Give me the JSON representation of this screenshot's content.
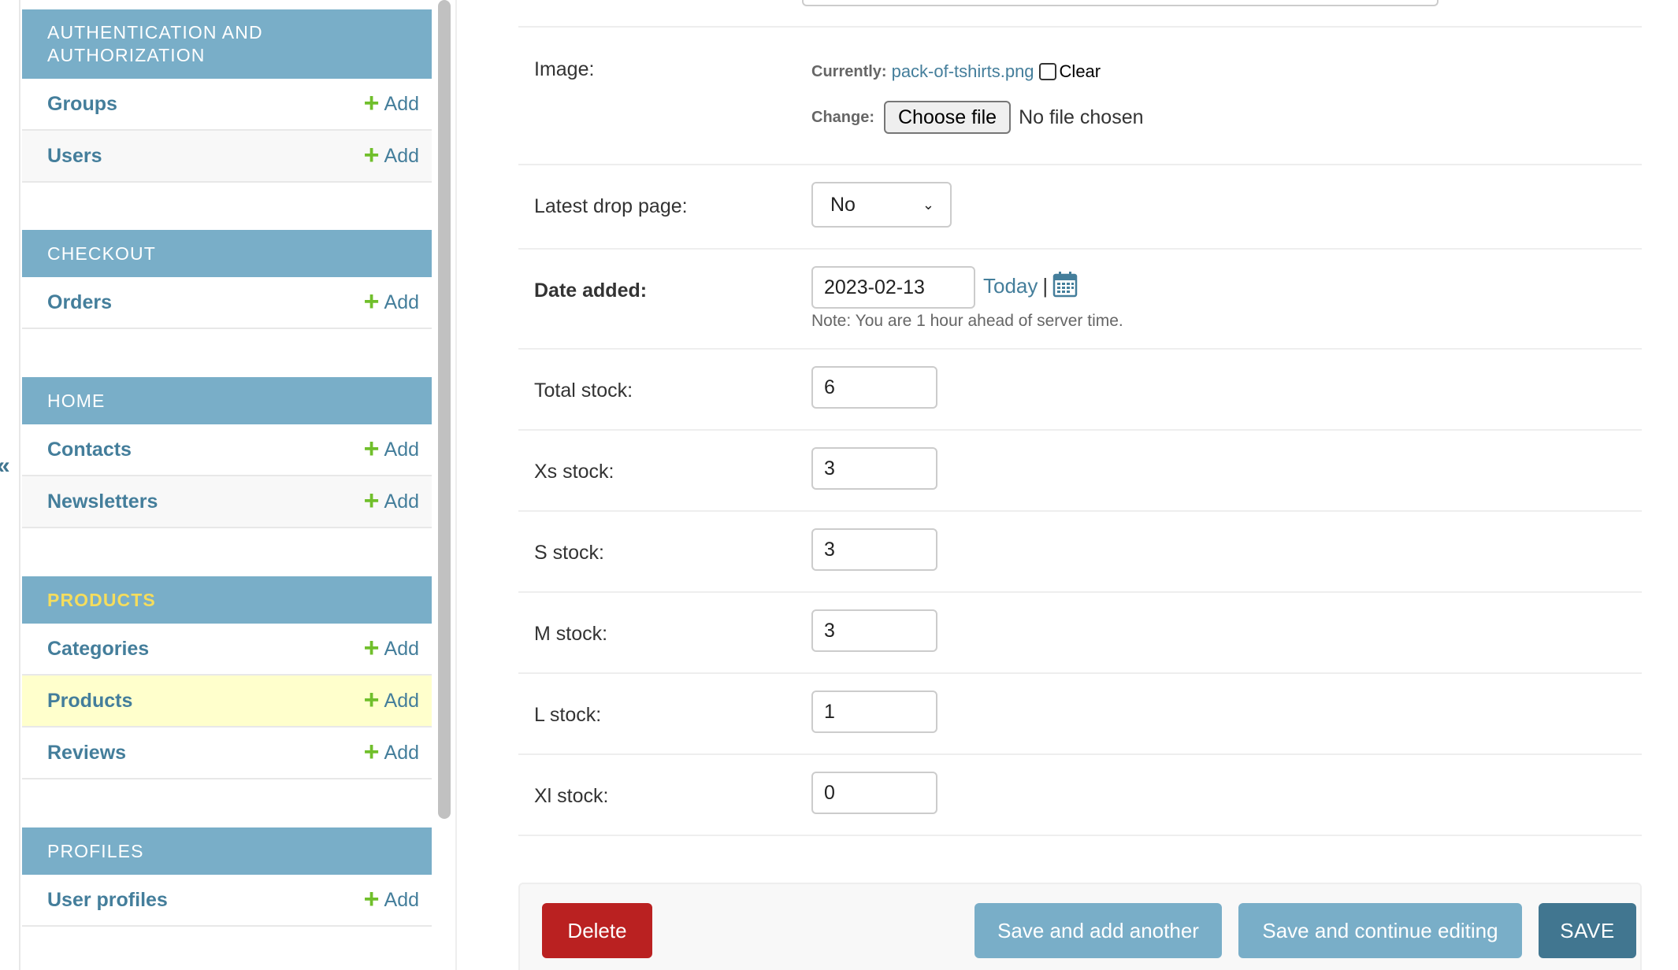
{
  "sidebar": {
    "collapse_glyph": "«",
    "modules": [
      {
        "title": "Authentication and Authorization",
        "models": [
          {
            "name": "Groups",
            "add_label": "Add"
          },
          {
            "name": "Users",
            "add_label": "Add"
          }
        ]
      },
      {
        "title": "Checkout",
        "models": [
          {
            "name": "Orders",
            "add_label": "Add"
          }
        ]
      },
      {
        "title": "Home",
        "models": [
          {
            "name": "Contacts",
            "add_label": "Add"
          },
          {
            "name": "Newsletters",
            "add_label": "Add"
          }
        ]
      },
      {
        "title": "Products",
        "active": true,
        "models": [
          {
            "name": "Categories",
            "add_label": "Add"
          },
          {
            "name": "Products",
            "add_label": "Add",
            "current": true
          },
          {
            "name": "Reviews",
            "add_label": "Add"
          }
        ]
      },
      {
        "title": "Profiles",
        "models": [
          {
            "name": "User profiles",
            "add_label": "Add"
          }
        ]
      }
    ]
  },
  "form": {
    "image": {
      "label": "Image:",
      "currently_label": "Currently:",
      "current_file": "pack-of-tshirts.png",
      "clear_label": "Clear",
      "change_label": "Change:",
      "choose_file_label": "Choose file",
      "no_file_text": "No file chosen"
    },
    "latest_drop_page": {
      "label": "Latest drop page:",
      "value": "No"
    },
    "date_added": {
      "label": "Date added:",
      "value": "2023-02-13",
      "today_label": "Today",
      "separator": "|",
      "note": "Note: You are 1 hour ahead of server time."
    },
    "total_stock": {
      "label": "Total stock:",
      "value": "6"
    },
    "xs_stock": {
      "label": "Xs stock:",
      "value": "3"
    },
    "s_stock": {
      "label": "S stock:",
      "value": "3"
    },
    "m_stock": {
      "label": "M stock:",
      "value": "3"
    },
    "l_stock": {
      "label": "L stock:",
      "value": "1"
    },
    "xl_stock": {
      "label": "Xl stock:",
      "value": "0"
    }
  },
  "submit": {
    "delete_label": "Delete",
    "save_add_another_label": "Save and add another",
    "save_continue_label": "Save and continue editing",
    "save_label": "SAVE"
  },
  "colors": {
    "module_header": "#79aec8",
    "link": "#447e9b",
    "add_plus": "#70bf2b",
    "current_row": "#ffffcc",
    "delete": "#ba2121",
    "save": "#417690"
  }
}
